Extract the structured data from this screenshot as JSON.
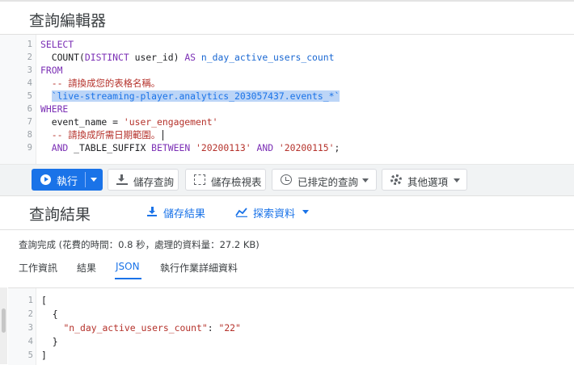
{
  "header": {
    "title": "查詢編輯器"
  },
  "editor": {
    "lines": [
      {
        "n": "1",
        "parts": [
          {
            "t": "SELECT",
            "c": "kw"
          }
        ]
      },
      {
        "n": "2",
        "parts": [
          {
            "t": "  COUNT(",
            "c": "plain"
          },
          {
            "t": "DISTINCT",
            "c": "kw"
          },
          {
            "t": " user_id) ",
            "c": "plain"
          },
          {
            "t": "AS",
            "c": "kw"
          },
          {
            "t": " n_day_active_users_count",
            "c": "alias"
          }
        ]
      },
      {
        "n": "3",
        "parts": [
          {
            "t": "FROM",
            "c": "kw"
          }
        ]
      },
      {
        "n": "4",
        "parts": [
          {
            "t": "  -- 請換成您的表格名稱。",
            "c": "cm"
          }
        ]
      },
      {
        "n": "5",
        "parts": [
          {
            "t": "  ",
            "c": "plain"
          },
          {
            "t": "`live-streaming-player.analytics_203057437.events_*`",
            "c": "sel"
          }
        ]
      },
      {
        "n": "6",
        "parts": [
          {
            "t": "WHERE",
            "c": "kw"
          }
        ]
      },
      {
        "n": "7",
        "parts": [
          {
            "t": "  event_name = ",
            "c": "plain"
          },
          {
            "t": "'user_engagement'",
            "c": "str"
          }
        ]
      },
      {
        "n": "8",
        "parts": [
          {
            "t": "  -- 請換成所需日期範圍。",
            "c": "cm"
          }
        ],
        "cursor": true
      },
      {
        "n": "9",
        "parts": [
          {
            "t": "  ",
            "c": "plain"
          },
          {
            "t": "AND",
            "c": "kw"
          },
          {
            "t": " _TABLE_SUFFIX ",
            "c": "plain"
          },
          {
            "t": "BETWEEN",
            "c": "kw"
          },
          {
            "t": " ",
            "c": "plain"
          },
          {
            "t": "'20200113'",
            "c": "str"
          },
          {
            "t": " ",
            "c": "plain"
          },
          {
            "t": "AND",
            "c": "kw"
          },
          {
            "t": " ",
            "c": "plain"
          },
          {
            "t": "'20200115'",
            "c": "str"
          },
          {
            "t": ";",
            "c": "plain"
          }
        ]
      }
    ]
  },
  "toolbar": {
    "run_label": "執行",
    "save_query_label": "儲存查詢",
    "save_view_label": "儲存檢視表",
    "scheduled_query_label": "已排定的查詢",
    "more_options_label": "其他選項"
  },
  "results": {
    "title": "查詢結果",
    "save_results_label": "儲存結果",
    "explore_data_label": "探索資料",
    "status": "查詢完成 (花費的時間：0.8 秒，處理的資料量：27.2 KB)",
    "tabs": [
      {
        "label": "工作資訊",
        "active": false
      },
      {
        "label": "結果",
        "active": false
      },
      {
        "label": "JSON",
        "active": true
      },
      {
        "label": "執行作業詳細資料",
        "active": false
      }
    ]
  },
  "json_output": {
    "lines": [
      {
        "n": "1",
        "text": "["
      },
      {
        "n": "2",
        "text": "  {"
      },
      {
        "n": "3",
        "key": "\"n_day_active_users_count\"",
        "sep": ": ",
        "value": "\"22\""
      },
      {
        "n": "4",
        "text": "  }"
      },
      {
        "n": "5",
        "text": "]"
      }
    ]
  },
  "colors": {
    "accent": "#1a73e8",
    "keyword": "#7b2fb5",
    "string": "#b5322b",
    "selection": "#bcd5f7"
  }
}
